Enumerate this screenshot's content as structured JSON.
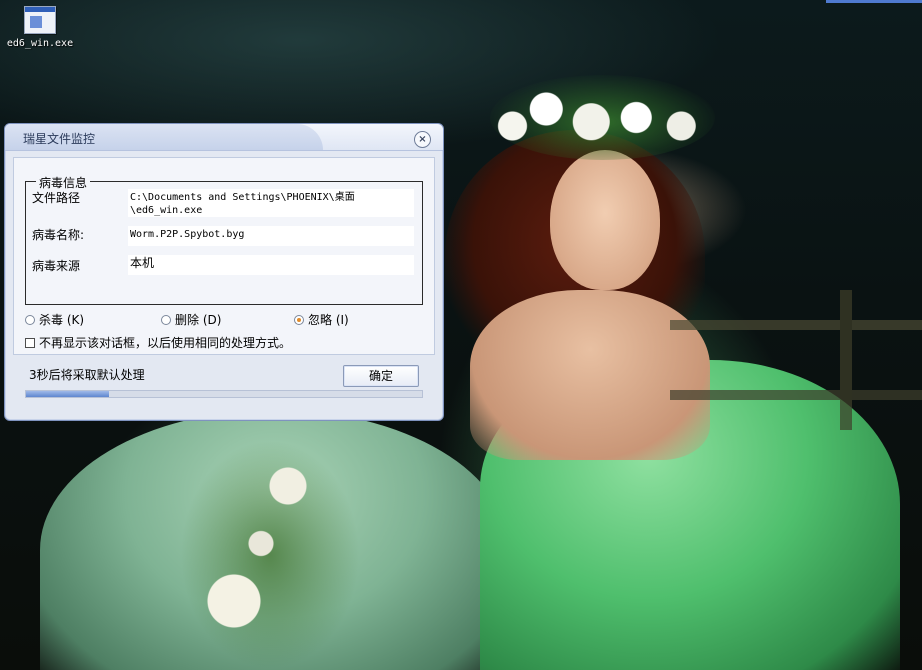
{
  "desktop": {
    "icons": [
      {
        "label": "ed6_win.exe"
      }
    ]
  },
  "dialog": {
    "title": "瑞星文件监控",
    "close_symbol": "×",
    "group_title": "病毒信息",
    "fields": [
      {
        "label": "文件路径",
        "value_line1": "C:\\Documents and Settings\\PHOENIX\\桌面",
        "value_line2": "\\ed6_win.exe"
      },
      {
        "label": "病毒名称:",
        "value": "Worm.P2P.Spybot.byg"
      },
      {
        "label": "病毒来源",
        "value": "本机"
      }
    ],
    "options": [
      {
        "label": "杀毒 (K)",
        "checked": false
      },
      {
        "label": "删除 (D)",
        "checked": false
      },
      {
        "label": "忽略 (I)",
        "checked": true
      }
    ],
    "checkbox_label": "不再显示该对话框，以后使用相同的处理方式。",
    "footer_text": "3秒后将采取默认处理",
    "ok_label": "确定",
    "progress_percent": 21
  },
  "colors": {
    "accent": "#5e86cf",
    "radio_selected": "#e08b2a"
  }
}
